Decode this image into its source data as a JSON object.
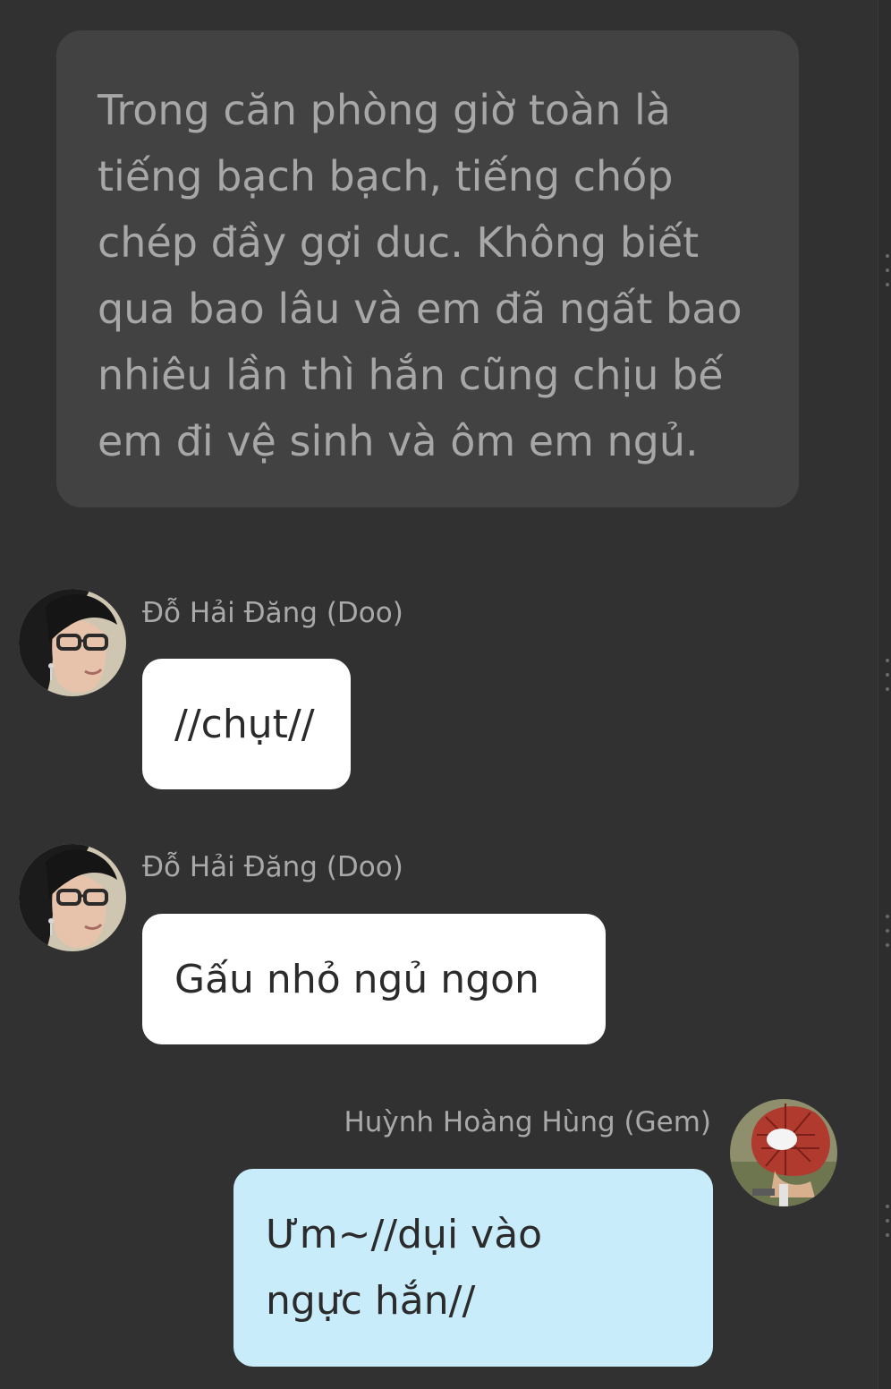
{
  "narration": {
    "text": "Trong căn phòng giờ toàn là\ntiếng bạch bạch, tiếng chóp\nchép đầy gợi duc. Không biết\nqua bao lâu và em đã ngất bao\nnhiêu lần thì hắn cũng chịu bế\nem đi vệ sinh và ôm em ngủ."
  },
  "messages": [
    {
      "sender": "Đỗ Hải Đăng (Doo)",
      "text": "//chụt//",
      "side": "left",
      "bubble_color": "#ffffff"
    },
    {
      "sender": "Đỗ Hải Đăng (Doo)",
      "text": "Gấu nhỏ ngủ ngon",
      "side": "left",
      "bubble_color": "#ffffff"
    },
    {
      "sender": "Huỳnh Hoàng Hùng (Gem)",
      "text": "Ưm~//dụi vào\nngực hắn//",
      "side": "right",
      "bubble_color": "#c9ecfb"
    }
  ],
  "colors": {
    "background": "#313131",
    "narration_bg": "#424242",
    "narration_text": "#a7a7a7",
    "name_text": "#a9a9a9"
  }
}
